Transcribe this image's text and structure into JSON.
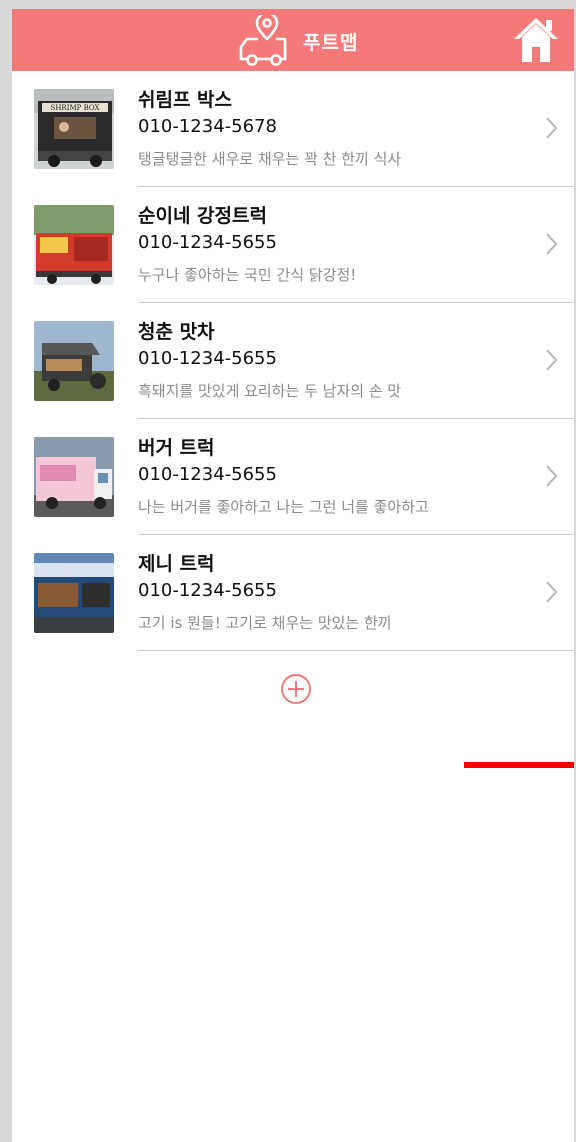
{
  "header": {
    "title": "푸트맵",
    "logo_icon": "truck-location-pin-icon",
    "home_icon": "home-icon"
  },
  "colors": {
    "header_bg": "#f47a7a",
    "accent": "#f47a7a",
    "description_text": "#8c8c8c",
    "red_line": "#f20000"
  },
  "trucks": [
    {
      "name": "쉬림프 박스",
      "phone": "010-1234-5678",
      "description": "탱글탱글한 새우로 채우는 꽉 찬 한끼 식사",
      "thumb_sign": "SHRIMP BOX"
    },
    {
      "name": "순이네 강정트럭",
      "phone": "010-1234-5655",
      "description": "누구나 좋아하는 국민 간식 닭강정!"
    },
    {
      "name": "청춘 맛차",
      "phone": "010-1234-5655",
      "description": "흑돼지를 맛있게 요리하는 두 남자의 손 맛"
    },
    {
      "name": "버거 트럭",
      "phone": "010-1234-5655",
      "description": "나는 버거를 좋아하고 나는 그런 너를 좋아하고"
    },
    {
      "name": "제니 트럭",
      "phone": "010-1234-5655",
      "description": "고기 is 뭔들! 고기로 채우는 맛있는 한끼"
    }
  ],
  "add_button": {
    "icon": "plus-circle-icon"
  }
}
